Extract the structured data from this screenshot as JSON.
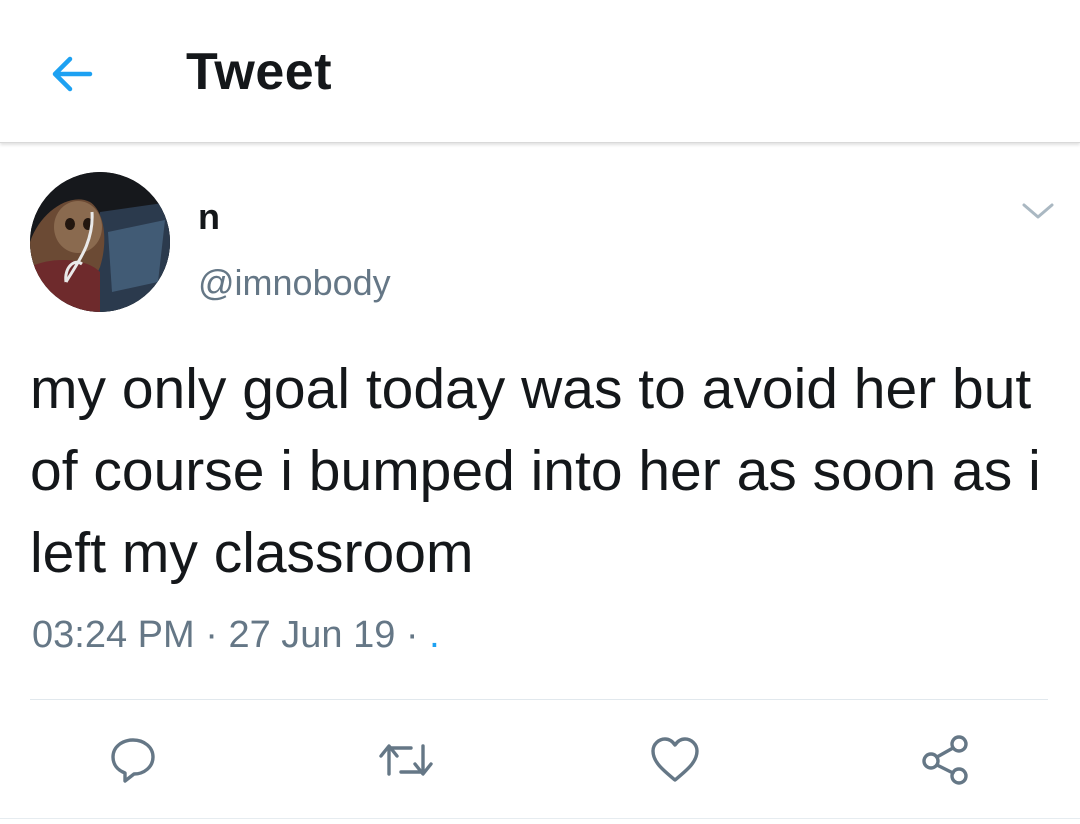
{
  "header": {
    "back_icon": "arrow-left-icon",
    "title": "Tweet",
    "accent_color": "#1da1f2"
  },
  "tweet": {
    "author": {
      "display_name": "n",
      "handle": "@imnobody",
      "avatar": "avatar-photo"
    },
    "text": "my only goal today was to avoid her but of course i bumped into her as soon as i left my classroom",
    "time": "03:24 PM",
    "separator": "·",
    "date": "27 Jun 19",
    "source": ".",
    "menu_icon": "chevron-down-icon"
  },
  "actions": [
    {
      "name": "reply",
      "icon": "reply-icon"
    },
    {
      "name": "retweet",
      "icon": "retweet-icon"
    },
    {
      "name": "like",
      "icon": "heart-icon"
    },
    {
      "name": "share",
      "icon": "share-icon"
    }
  ],
  "colors": {
    "text": "#14171a",
    "secondary": "#657786",
    "icon_gray": "#657786"
  }
}
